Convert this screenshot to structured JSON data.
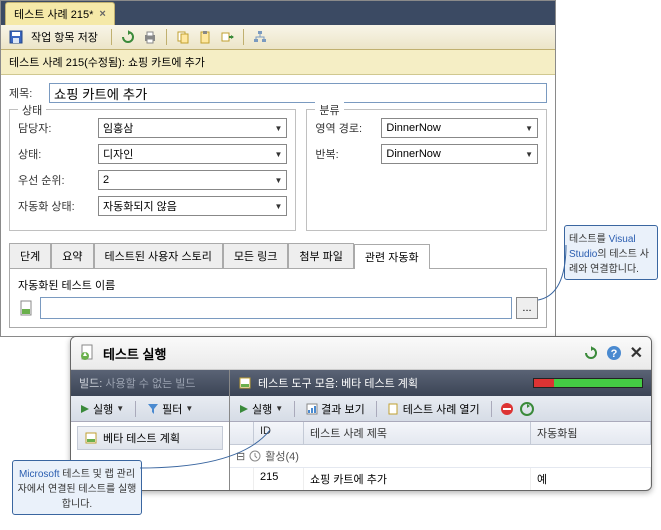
{
  "tab": {
    "title": "테스트 사례 215*"
  },
  "toolbar": {
    "save_label": "작업 항목 저장"
  },
  "title_band": "테스트 사례 215(수정됨): 쇼핑 카트에 추가",
  "title_field": {
    "label": "제목:",
    "value": "쇼핑 카트에 추가"
  },
  "status_panel": {
    "heading": "상태",
    "assignee": {
      "label": "담당자:",
      "value": "임홍삼"
    },
    "state": {
      "label": "상태:",
      "value": "디자인"
    },
    "priority": {
      "label": "우선 순위:",
      "value": "2"
    },
    "automation": {
      "label": "자동화 상태:",
      "value": "자동화되지 않음"
    }
  },
  "class_panel": {
    "heading": "분류",
    "area": {
      "label": "영역 경로:",
      "value": "DinnerNow"
    },
    "iteration": {
      "label": "반복:",
      "value": "DinnerNow"
    }
  },
  "sub_tabs": {
    "steps": "단계",
    "summary": "요약",
    "tested_story": "테스트된 사용자 스토리",
    "all_links": "모든 링크",
    "attachments": "첨부 파일",
    "related_auto": "관련 자동화"
  },
  "auto_panel": {
    "label": "자동화된 테스트 이름",
    "ellipsis": "..."
  },
  "callout1": {
    "prefix": "테스트를 ",
    "vs": "Visual Studio",
    "suffix": "의 테스트 사례와 연결합니다."
  },
  "callout2": {
    "ms": "Microsoft",
    "rest": " 테스트 및 랩 관리자에서 연결된 테스트를 실행합니다."
  },
  "run_window": {
    "title": "테스트 실행",
    "build_label": "빌드:",
    "build_value": "사용할 수 없는 빌드",
    "run_menu": "실행",
    "filter": "필터",
    "plan_item": "베타 테스트 계획",
    "suite_label": "테스트 도구 모음: 베타 테스트 계획",
    "view_results": "결과 보기",
    "open_case": "테스트 사례 열기",
    "grid": {
      "col_id": "ID",
      "col_title": "테스트 사례 제목",
      "col_auto": "자동화됨",
      "group": "활성(4)",
      "row": {
        "id": "215",
        "title": "쇼핑 카트에 추가",
        "auto": "예"
      }
    }
  }
}
